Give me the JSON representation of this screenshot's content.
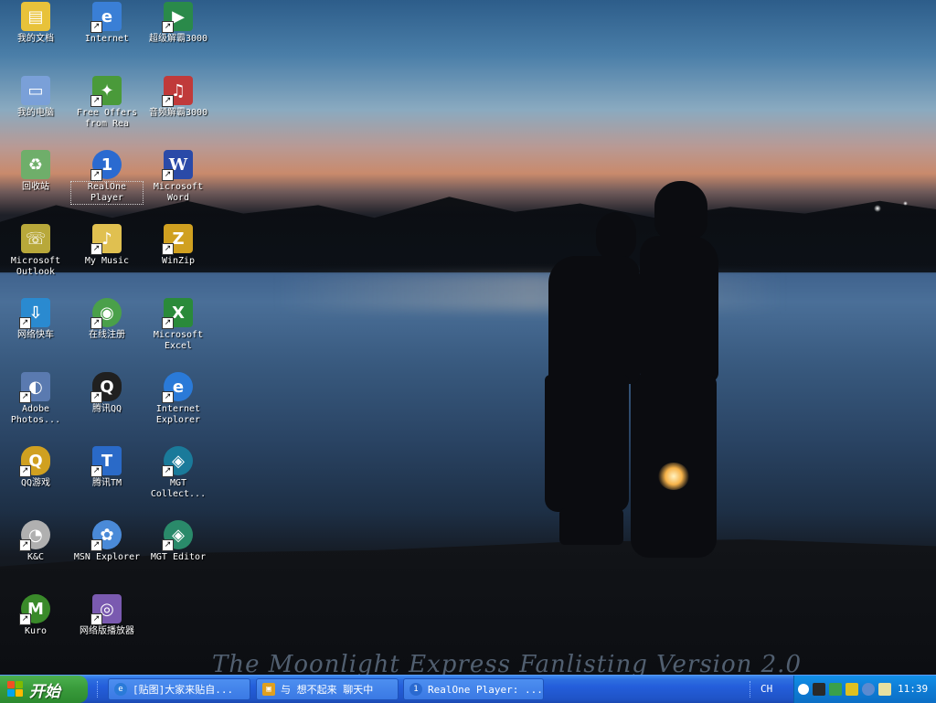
{
  "desktop": {
    "watermark": "The Moonlight Express Fanlisting Version 2.0",
    "icons": [
      {
        "label": "我的文档",
        "icon": "folder-documents-icon",
        "color": "#e8c23a",
        "glyph": "📁",
        "shortcut": false
      },
      {
        "label": "Internet",
        "icon": "internet-icon",
        "color": "#3a7fd6",
        "glyph": "e",
        "shortcut": true
      },
      {
        "label": "超级解霸3000",
        "icon": "player-icon",
        "color": "#2a8a4a",
        "glyph": "▶",
        "shortcut": true
      },
      {
        "label": "我的电脑",
        "icon": "computer-icon",
        "color": "#7aa0d8",
        "glyph": "▭",
        "shortcut": false
      },
      {
        "label": "Free Offers\nfrom Rea",
        "icon": "gift-icon",
        "color": "#4a9a3a",
        "glyph": "✦",
        "shortcut": true
      },
      {
        "label": "音频解霸3000",
        "icon": "audio-player-icon",
        "color": "#c03a3a",
        "glyph": "♫",
        "shortcut": true
      },
      {
        "label": "回收站",
        "icon": "recycle-bin-icon",
        "color": "#6fae6a",
        "glyph": "♻",
        "shortcut": false
      },
      {
        "label": "RealOne\nPlayer",
        "icon": "realone-icon",
        "color": "#2a6ad0",
        "glyph": "1",
        "shortcut": true
      },
      {
        "label": "Microsoft\nWord",
        "icon": "word-icon",
        "color": "#2a4aa8",
        "glyph": "W",
        "shortcut": true
      },
      {
        "label": "Microsoft\nOutlook",
        "icon": "outlook-icon",
        "color": "#b8a83a",
        "glyph": "☏",
        "shortcut": false
      },
      {
        "label": "My Music",
        "icon": "music-folder-icon",
        "color": "#e0c050",
        "glyph": "♪",
        "shortcut": true
      },
      {
        "label": "WinZip",
        "icon": "winzip-icon",
        "color": "#d0a020",
        "glyph": "Z",
        "shortcut": true
      },
      {
        "label": "网络快车",
        "icon": "download-icon",
        "color": "#2a8ad0",
        "glyph": "⇩",
        "shortcut": true
      },
      {
        "label": "在线注册",
        "icon": "register-icon",
        "color": "#4aa04a",
        "glyph": "◉",
        "shortcut": true
      },
      {
        "label": "Microsoft\nExcel",
        "icon": "excel-icon",
        "color": "#2a8a3a",
        "glyph": "X",
        "shortcut": true
      },
      {
        "label": "Adobe\nPhotos...",
        "icon": "photoshop-icon",
        "color": "#5a7ab0",
        "glyph": "◐",
        "shortcut": true
      },
      {
        "label": "腾讯QQ",
        "icon": "qq-icon",
        "color": "#202020",
        "glyph": "Q",
        "shortcut": true
      },
      {
        "label": "Internet\nExplorer",
        "icon": "ie-icon",
        "color": "#2a7ad8",
        "glyph": "e",
        "shortcut": true
      },
      {
        "label": "QQ游戏",
        "icon": "qq-game-icon",
        "color": "#d0a020",
        "glyph": "Q",
        "shortcut": true
      },
      {
        "label": "腾讯TM",
        "icon": "tm-icon",
        "color": "#2a6ac8",
        "glyph": "T",
        "shortcut": true
      },
      {
        "label": "MGT\nCollect...",
        "icon": "mgt-collect-icon",
        "color": "#1a7a9a",
        "glyph": "◈",
        "shortcut": true
      },
      {
        "label": "K&C",
        "icon": "kc-icon",
        "color": "#b0b0b0",
        "glyph": "◔",
        "shortcut": true
      },
      {
        "label": "MSN Explorer",
        "icon": "msn-icon",
        "color": "#4a8ad8",
        "glyph": "✿",
        "shortcut": true
      },
      {
        "label": "MGT Editor",
        "icon": "mgt-editor-icon",
        "color": "#2a8a6a",
        "glyph": "◈",
        "shortcut": true
      },
      {
        "label": "Kuro",
        "icon": "kuro-icon",
        "color": "#3a8a2a",
        "glyph": "M",
        "shortcut": true
      },
      {
        "label": "网络版播放器",
        "icon": "network-player-icon",
        "color": "#7a5ab0",
        "glyph": "◎",
        "shortcut": true
      }
    ]
  },
  "taskbar": {
    "start_label": "开始",
    "tasks": [
      {
        "label": "[贴图]大家来贴自...",
        "icon": "ie-icon",
        "color": "#2a7ad8"
      },
      {
        "label": "与 想不起来 聊天中",
        "icon": "chat-icon",
        "color": "#e0a020"
      },
      {
        "label": "RealOne Player: ...",
        "icon": "realone-icon",
        "color": "#2a6ad0"
      }
    ],
    "tray": {
      "language": "CH",
      "clock": "11:39"
    }
  }
}
